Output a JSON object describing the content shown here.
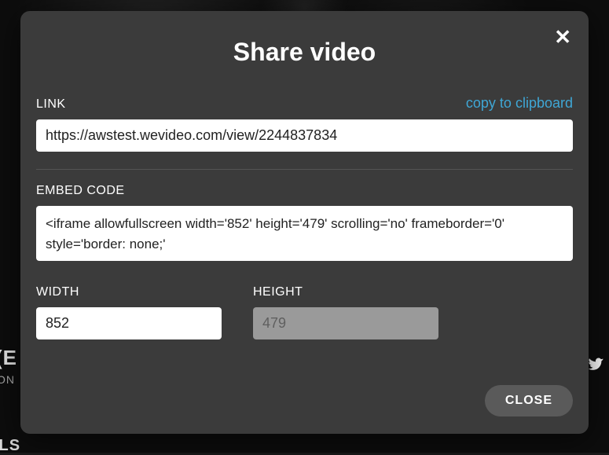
{
  "modal": {
    "title": "Share video",
    "link_label": "LINK",
    "copy_label": "copy to clipboard",
    "link_value": "https://awstest.wevideo.com/view/2244837834",
    "embed_label": "EMBED CODE",
    "embed_value": "<iframe allowfullscreen width='852' height='479' scrolling='no' frameborder='0' style='border: none;'",
    "width_label": "WIDTH",
    "width_value": "852",
    "height_label": "HEIGHT",
    "height_value": "479",
    "close_button": "CLOSE"
  },
  "background": {
    "left_cut1": "(E",
    "left_cut2": "ON",
    "bottom_cut": "ILS"
  }
}
